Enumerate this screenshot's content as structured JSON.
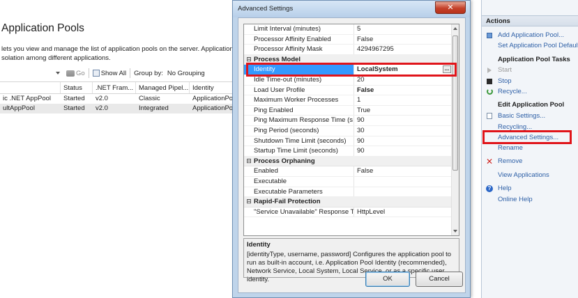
{
  "main": {
    "title": "Application Pools",
    "desc_line1": "lets you view and manage the list of application pools on the server. Application",
    "desc_line2": "solation among different applications.",
    "toolbar": {
      "go_label": "Go",
      "show_all_label": "Show All",
      "group_by_label": "Group by:",
      "group_by_value": "No Grouping"
    },
    "grid": {
      "headers": [
        "",
        "Status",
        ".NET Fram...",
        "Managed Pipel...",
        "Identity"
      ],
      "rows": [
        [
          "ic .NET AppPool",
          "Started",
          "v2.0",
          "Classic",
          "ApplicationPo"
        ],
        [
          "ultAppPool",
          "Started",
          "v2.0",
          "Integrated",
          "ApplicationPo"
        ]
      ]
    }
  },
  "actions": {
    "header": "Actions",
    "add_app_pool": "Add Application Pool...",
    "set_defaults": "Set Application Pool Defaults",
    "tasks_header": "Application Pool Tasks",
    "start": "Start",
    "stop": "Stop",
    "recycle": "Recycle...",
    "edit_header": "Edit Application Pool",
    "basic_settings": "Basic Settings...",
    "recycling": "Recycling...",
    "advanced_settings": "Advanced Settings...",
    "rename": "Rename",
    "remove": "Remove",
    "view_applications": "View Applications",
    "help": "Help",
    "online_help": "Online Help"
  },
  "dialog": {
    "title": "Advanced Settings",
    "close_glyph": "✕",
    "props": {
      "limit_interval": {
        "name": "Limit Interval (minutes)",
        "value": "5"
      },
      "proc_affinity_enabled": {
        "name": "Processor Affinity Enabled",
        "value": "False"
      },
      "proc_affinity_mask": {
        "name": "Processor Affinity Mask",
        "value": "4294967295"
      },
      "cat_process_model": "Process Model",
      "identity": {
        "name": "Identity",
        "value": "LocalSystem",
        "button": "..."
      },
      "idle_timeout": {
        "name": "Idle Time-out (minutes)",
        "value": "20"
      },
      "load_user_profile": {
        "name": "Load User Profile",
        "value": "False"
      },
      "max_worker": {
        "name": "Maximum Worker Processes",
        "value": "1"
      },
      "ping_enabled": {
        "name": "Ping Enabled",
        "value": "True"
      },
      "ping_max_response": {
        "name": "Ping Maximum Response Time (s",
        "value": "90"
      },
      "ping_period": {
        "name": "Ping Period (seconds)",
        "value": "30"
      },
      "shutdown_limit": {
        "name": "Shutdown Time Limit (seconds)",
        "value": "90"
      },
      "startup_limit": {
        "name": "Startup Time Limit (seconds)",
        "value": "90"
      },
      "cat_orphaning": "Process Orphaning",
      "orph_enabled": {
        "name": "Enabled",
        "value": "False"
      },
      "orph_exe": {
        "name": "Executable",
        "value": ""
      },
      "orph_params": {
        "name": "Executable Parameters",
        "value": ""
      },
      "cat_rapid_fail": "Rapid-Fail Protection",
      "svc_unavail": {
        "name": "\"Service Unavailable\" Response Ty",
        "value": "HttpLevel"
      }
    },
    "description": {
      "title": "Identity",
      "text": "[identityType, username, password] Configures the application pool to run as built-in account, i.e. Application Pool Identity (recommended), Network Service, Local System, Local Service, or as a specific user identity."
    },
    "ok_label": "OK",
    "cancel_label": "Cancel"
  },
  "colors": {
    "highlight_red": "#e0141a",
    "selection_blue": "#3399ff",
    "link_blue": "#2d5fa6"
  }
}
